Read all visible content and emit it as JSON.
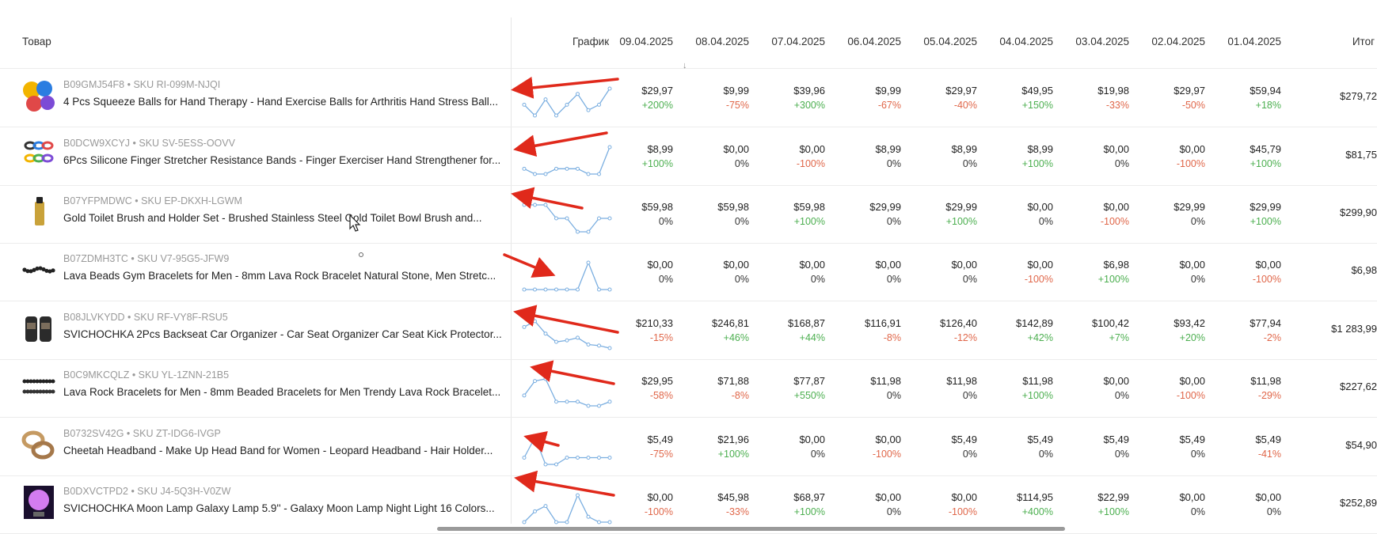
{
  "header": {
    "product": "Товар",
    "chart": "График",
    "dates": [
      "09.04.2025",
      "08.04.2025",
      "07.04.2025",
      "06.04.2025",
      "05.04.2025",
      "04.04.2025",
      "03.04.2025",
      "02.04.2025",
      "01.04.2025"
    ],
    "total": "Итог"
  },
  "sort_icon": "↓",
  "rows": [
    {
      "sku": "B09GMJ54F8 • SKU RI-099M-NJQI",
      "title": "4 Pcs Squeeze Balls for Hand Therapy - Hand Exercise Balls for Arthritis Hand Stress Ball...",
      "thumb_icon": "colorful-balls-thumbnail",
      "prices": [
        "$29,97",
        "$9,99",
        "$39,96",
        "$9,99",
        "$29,97",
        "$49,95",
        "$19,98",
        "$29,97",
        "$59,94"
      ],
      "changes": [
        "+200%",
        "-75%",
        "+300%",
        "-67%",
        "-40%",
        "+150%",
        "-33%",
        "-50%",
        "+18%"
      ],
      "total": "$279,72",
      "trend": [
        29.97,
        9.99,
        39.96,
        9.99,
        29.97,
        49.95,
        19.98,
        29.97,
        59.94
      ]
    },
    {
      "sku": "B0DCW9XCYJ • SKU SV-5ESS-OOVV",
      "title": "6Pcs Silicone Finger Stretcher Resistance Bands - Finger Exerciser Hand Strengthener for...",
      "thumb_icon": "finger-bands-thumbnail",
      "prices": [
        "$8,99",
        "$0,00",
        "$0,00",
        "$8,99",
        "$8,99",
        "$8,99",
        "$0,00",
        "$0,00",
        "$45,79"
      ],
      "changes": [
        "+100%",
        "0%",
        "-100%",
        "0%",
        "0%",
        "+100%",
        "0%",
        "-100%",
        "+100%"
      ],
      "total": "$81,75",
      "trend": [
        8.99,
        0,
        0,
        8.99,
        8.99,
        8.99,
        0,
        0,
        45.79
      ]
    },
    {
      "sku": "B07YFPMDWC • SKU EP-DKXH-LGWM",
      "title": "Gold Toilet Brush and Holder Set - Brushed Stainless Steel Gold Toilet Bowl Brush and...",
      "thumb_icon": "gold-brush-thumbnail",
      "prices": [
        "$59,98",
        "$59,98",
        "$59,98",
        "$29,99",
        "$29,99",
        "$0,00",
        "$0,00",
        "$29,99",
        "$29,99"
      ],
      "changes": [
        "0%",
        "0%",
        "+100%",
        "0%",
        "+100%",
        "0%",
        "-100%",
        "0%",
        "+100%"
      ],
      "total": "$299,90",
      "trend": [
        59.98,
        59.98,
        59.98,
        29.99,
        29.99,
        0,
        0,
        29.99,
        29.99
      ]
    },
    {
      "sku": "B07ZDMH3TC • SKU V7-95G5-JFW9",
      "title": "Lava Beads Gym Bracelets for Men - 8mm Lava Rock Bracelet Natural Stone, Men Stretc...",
      "thumb_icon": "black-bracelet-thumbnail",
      "prices": [
        "$0,00",
        "$0,00",
        "$0,00",
        "$0,00",
        "$0,00",
        "$0,00",
        "$6,98",
        "$0,00",
        "$0,00"
      ],
      "changes": [
        "0%",
        "0%",
        "0%",
        "0%",
        "0%",
        "-100%",
        "+100%",
        "0%",
        "-100%"
      ],
      "total": "$6,98",
      "trend": [
        0,
        0,
        0,
        0,
        0,
        0,
        6.98,
        0,
        0
      ]
    },
    {
      "sku": "B08JLVKYDD • SKU RF-VY8F-RSU5",
      "title": "SVICHOCHKA 2Pcs Backseat Car Organizer - Car Seat Organizer Car Seat Kick Protector...",
      "thumb_icon": "car-organizer-thumbnail",
      "prices": [
        "$210,33",
        "$246,81",
        "$168,87",
        "$116,91",
        "$126,40",
        "$142,89",
        "$100,42",
        "$93,42",
        "$77,94"
      ],
      "changes": [
        "-15%",
        "+46%",
        "+44%",
        "-8%",
        "-12%",
        "+42%",
        "+7%",
        "+20%",
        "-2%"
      ],
      "total": "$1 283,99",
      "trend": [
        210.33,
        246.81,
        168.87,
        116.91,
        126.4,
        142.89,
        100.42,
        93.42,
        77.94
      ]
    },
    {
      "sku": "B0C9MKCQLZ • SKU YL-1ZNN-21B5",
      "title": "Lava Rock Bracelets for Men - 8mm Beaded Bracelets for Men Trendy Lava Rock Bracelet...",
      "thumb_icon": "bracelets-pair-thumbnail",
      "prices": [
        "$29,95",
        "$71,88",
        "$77,87",
        "$11,98",
        "$11,98",
        "$11,98",
        "$0,00",
        "$0,00",
        "$11,98"
      ],
      "changes": [
        "-58%",
        "-8%",
        "+550%",
        "0%",
        "0%",
        "+100%",
        "0%",
        "-100%",
        "-29%"
      ],
      "total": "$227,62",
      "trend": [
        29.95,
        71.88,
        77.87,
        11.98,
        11.98,
        11.98,
        0,
        0,
        11.98
      ]
    },
    {
      "sku": "B0732SV42G • SKU ZT-IDG6-IVGP",
      "title": "Cheetah Headband - Make Up Head Band for Women - Leopard Headband - Hair Holder...",
      "thumb_icon": "headband-thumbnail",
      "prices": [
        "$5,49",
        "$21,96",
        "$0,00",
        "$0,00",
        "$5,49",
        "$5,49",
        "$5,49",
        "$5,49",
        "$5,49"
      ],
      "changes": [
        "-75%",
        "+100%",
        "0%",
        "-100%",
        "0%",
        "0%",
        "0%",
        "0%",
        "-41%"
      ],
      "total": "$54,90",
      "trend": [
        5.49,
        21.96,
        0,
        0,
        5.49,
        5.49,
        5.49,
        5.49,
        5.49
      ]
    },
    {
      "sku": "B0DXVCTPD2 • SKU J4-5Q3H-V0ZW",
      "title": "SVICHOCHKA Moon Lamp Galaxy Lamp 5.9'' - Galaxy Moon Lamp Night Light 16 Colors...",
      "thumb_icon": "moon-lamp-thumbnail",
      "prices": [
        "$0,00",
        "$45,98",
        "$68,97",
        "$0,00",
        "$0,00",
        "$114,95",
        "$22,99",
        "$0,00",
        "$0,00"
      ],
      "changes": [
        "-100%",
        "-33%",
        "+100%",
        "0%",
        "-100%",
        "+400%",
        "+100%",
        "0%",
        "0%"
      ],
      "total": "$252,89",
      "trend": [
        0,
        45.98,
        68.97,
        0,
        0,
        114.95,
        22.99,
        0,
        0
      ]
    }
  ],
  "colors": {
    "positive": "#4caf50",
    "negative": "#e0674a",
    "spark": "#7aaee0",
    "arrow": "#e0291b"
  }
}
